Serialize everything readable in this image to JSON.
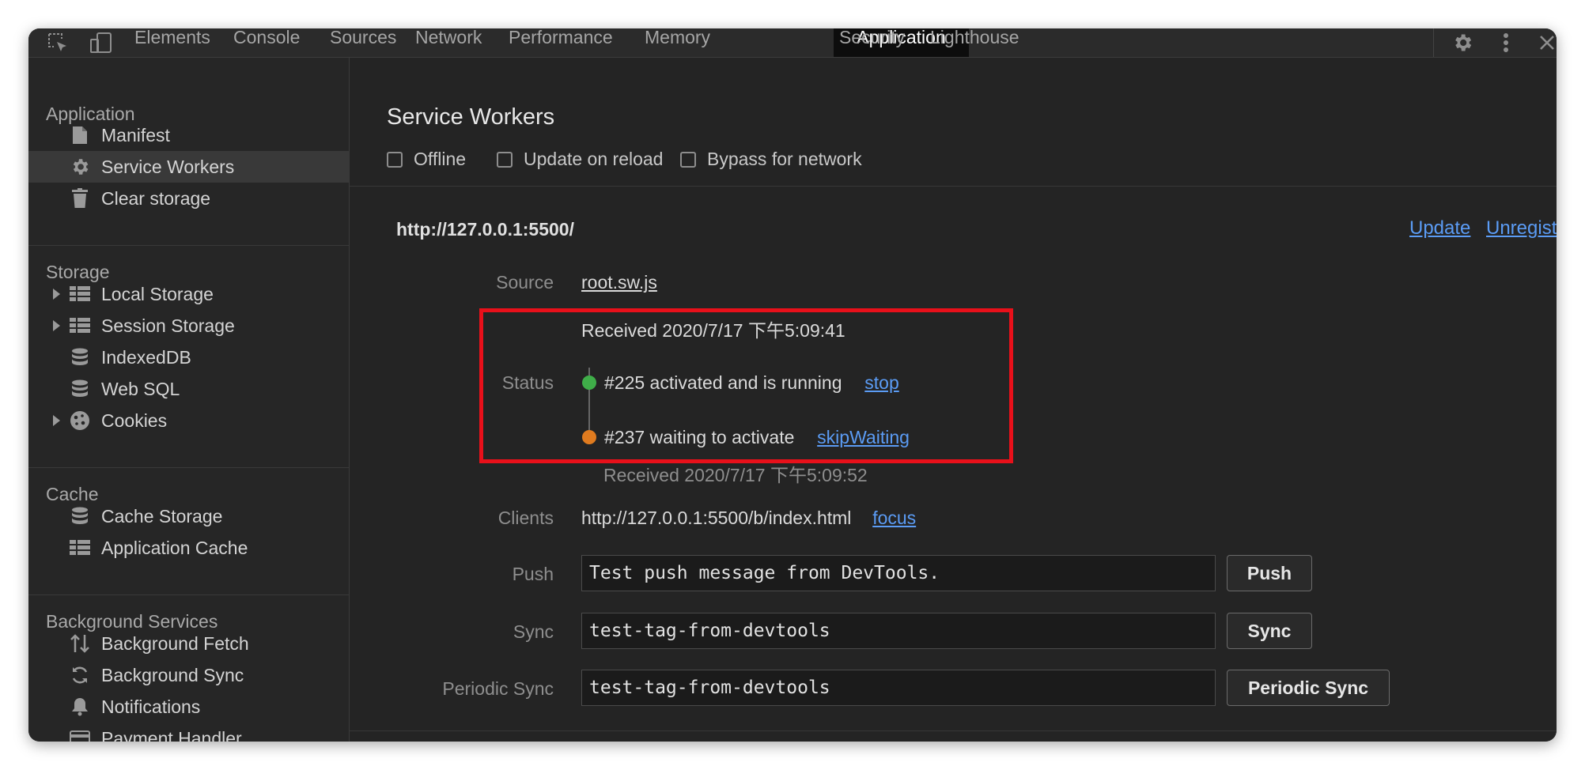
{
  "tabs": [
    "Elements",
    "Console",
    "Sources",
    "Network",
    "Performance",
    "Memory",
    "Application",
    "Security",
    "Lighthouse"
  ],
  "active_tab": "Application",
  "sidebar": {
    "application": {
      "title": "Application",
      "items": [
        {
          "label": "Manifest",
          "icon": "document-icon"
        },
        {
          "label": "Service Workers",
          "icon": "gear-icon"
        },
        {
          "label": "Clear storage",
          "icon": "trash-icon"
        }
      ]
    },
    "storage": {
      "title": "Storage",
      "items": [
        {
          "label": "Local Storage",
          "icon": "grid-icon"
        },
        {
          "label": "Session Storage",
          "icon": "grid-icon"
        },
        {
          "label": "IndexedDB",
          "icon": "database-icon"
        },
        {
          "label": "Web SQL",
          "icon": "database-icon"
        },
        {
          "label": "Cookies",
          "icon": "cookie-icon"
        }
      ]
    },
    "cache": {
      "title": "Cache",
      "items": [
        {
          "label": "Cache Storage",
          "icon": "database-icon"
        },
        {
          "label": "Application Cache",
          "icon": "grid-icon"
        }
      ]
    },
    "background": {
      "title": "Background Services",
      "items": [
        {
          "label": "Background Fetch",
          "icon": "up-down-arrows-icon"
        },
        {
          "label": "Background Sync",
          "icon": "sync-icon"
        },
        {
          "label": "Notifications",
          "icon": "bell-icon"
        },
        {
          "label": "Payment Handler",
          "icon": "card-icon"
        }
      ]
    }
  },
  "main": {
    "title": "Service Workers",
    "options": [
      "Offline",
      "Update on reload",
      "Bypass for network"
    ],
    "origin": "http://127.0.0.1:5500/",
    "update_link": "Update",
    "unregister_link": "Unregister",
    "source_label": "Source",
    "source_file": "root.sw.js",
    "source_received": "Received 2020/7/17 下午5:09:41",
    "status_label": "Status",
    "status_active": "#225 activated and is running",
    "status_active_color": "#3fae49",
    "stop_link": "stop",
    "status_waiting": "#237 waiting to activate",
    "status_waiting_color": "#e07b1f",
    "skip_link": "skipWaiting",
    "waiting_received": "Received 2020/7/17 下午5:09:52",
    "clients_label": "Clients",
    "client_url": "http://127.0.0.1:5500/b/index.html",
    "focus_link": "focus",
    "push_label": "Push",
    "push_value": "Test push message from DevTools.",
    "push_button": "Push",
    "sync_label": "Sync",
    "sync_value": "test-tag-from-devtools",
    "sync_button": "Sync",
    "periodic_label": "Periodic Sync",
    "periodic_value": "test-tag-from-devtools",
    "periodic_button": "Periodic Sync",
    "highlight_color": "#e8101a"
  }
}
